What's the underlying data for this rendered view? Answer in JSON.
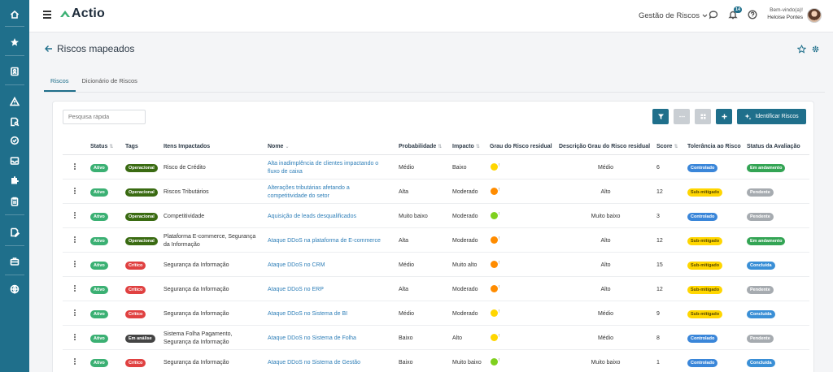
{
  "app": {
    "logo_text": "Actio",
    "module": "Gestão de Riscos",
    "notifications_count": "14"
  },
  "user": {
    "greeting": "Bem-vindo(a)!",
    "name": "Heloise Pontes"
  },
  "page": {
    "title": "Riscos mapeados"
  },
  "tabs": [
    {
      "label": "Riscos",
      "active": true
    },
    {
      "label": "Dicionário de Riscos",
      "active": false
    }
  ],
  "toolbar": {
    "search_placeholder": "Pesquisa rápida",
    "identify_label": "Identificar Riscos"
  },
  "columns": {
    "status": "Status",
    "tags": "Tags",
    "itens": "Itens Impactados",
    "nome": "Nome",
    "probabilidade": "Probabilidade",
    "impacto": "Impacto",
    "grau": "Grau do Risco residual",
    "descricao": "Descrição Grau do Risco residual",
    "score": "Score",
    "tolerancia": "Tolerância ao Risco",
    "avaliacao": "Status da Avaliação"
  },
  "colors": {
    "primary": "#1f6f8b",
    "ativo": "#3bb073",
    "operacional": "#3a6b12",
    "critico": "#e04141",
    "em_analise": "#444444",
    "controlado": "#3a86d9",
    "sub_mitigado": "#ffd600",
    "em_andamento": "#33a454",
    "pendente": "#a6abb0",
    "concluida": "#3a8fd6",
    "grau_yellow": "#ffd600",
    "grau_orange": "#ff8c00",
    "grau_green": "#7fd01f"
  },
  "rows": [
    {
      "status": "Ativo",
      "tag": "Operacional",
      "tag_type": "operacional",
      "itens": [
        "Risco de Crédito"
      ],
      "nome": [
        "Alta inadimplência de clientes impactando o",
        "fluxo de caixa"
      ],
      "probabilidade": "Médio",
      "impacto": "Baixo",
      "grau": "yellow",
      "descricao": "Médio",
      "score": "6",
      "tolerancia": "Controlado",
      "tol_type": "controlado",
      "avaliacao": "Em andamento",
      "av_type": "em_andamento"
    },
    {
      "status": "Ativo",
      "tag": "Operacional",
      "tag_type": "operacional",
      "itens": [
        "Riscos Tributários"
      ],
      "nome": [
        "Alterações tributárias afetando a",
        "competitividade do setor"
      ],
      "probabilidade": "Alta",
      "impacto": "Moderado",
      "grau": "orange",
      "descricao": "Alto",
      "score": "12",
      "tolerancia": "Sub-mitigado",
      "tol_type": "sub_mitigado",
      "avaliacao": "Pendente",
      "av_type": "pendente"
    },
    {
      "status": "Ativo",
      "tag": "Operacional",
      "tag_type": "operacional",
      "itens": [
        "Competitividade"
      ],
      "nome": [
        "Aquisição de leads desqualificados"
      ],
      "probabilidade": "Muito baixo",
      "impacto": "Moderado",
      "grau": "green",
      "descricao": "Muito baixo",
      "score": "3",
      "tolerancia": "Controlado",
      "tol_type": "controlado",
      "avaliacao": "Pendente",
      "av_type": "pendente"
    },
    {
      "status": "Ativo",
      "tag": "Operacional",
      "tag_type": "operacional",
      "itens": [
        "Plataforma E-commerce, Segurança",
        "da Informação"
      ],
      "nome": [
        "Ataque DDoS na plataforma de E-commerce"
      ],
      "probabilidade": "Alta",
      "impacto": "Moderado",
      "grau": "orange",
      "descricao": "Alto",
      "score": "12",
      "tolerancia": "Sub-mitigado",
      "tol_type": "sub_mitigado",
      "avaliacao": "Em andamento",
      "av_type": "em_andamento"
    },
    {
      "status": "Ativo",
      "tag": "Crítico",
      "tag_type": "critico",
      "itens": [
        "Segurança da Informação"
      ],
      "nome": [
        "Ataque DDoS no CRM"
      ],
      "probabilidade": "Médio",
      "impacto": "Muito alto",
      "grau": "orange",
      "descricao": "Alto",
      "score": "15",
      "tolerancia": "Sub-mitigado",
      "tol_type": "sub_mitigado",
      "avaliacao": "Concluída",
      "av_type": "concluida"
    },
    {
      "status": "Ativo",
      "tag": "Crítico",
      "tag_type": "critico",
      "itens": [
        "Segurança da Informação"
      ],
      "nome": [
        "Ataque DDoS no ERP"
      ],
      "probabilidade": "Alta",
      "impacto": "Moderado",
      "grau": "orange",
      "descricao": "Alto",
      "score": "12",
      "tolerancia": "Sub-mitigado",
      "tol_type": "sub_mitigado",
      "avaliacao": "Pendente",
      "av_type": "pendente"
    },
    {
      "status": "Ativo",
      "tag": "Crítico",
      "tag_type": "critico",
      "itens": [
        "Segurança da Informação"
      ],
      "nome": [
        "Ataque DDoS no Sistema de BI"
      ],
      "probabilidade": "Médio",
      "impacto": "Moderado",
      "grau": "yellow",
      "descricao": "Médio",
      "score": "9",
      "tolerancia": "Sub-mitigado",
      "tol_type": "sub_mitigado",
      "avaliacao": "Concluída",
      "av_type": "concluida"
    },
    {
      "status": "Ativo",
      "tag": "Em análise",
      "tag_type": "em_analise",
      "itens": [
        "Sistema Folha Pagamento,",
        "Segurança da Informação"
      ],
      "nome": [
        "Ataque DDoS no Sistema de Folha"
      ],
      "probabilidade": "Baixo",
      "impacto": "Alto",
      "grau": "yellow",
      "descricao": "Médio",
      "score": "8",
      "tolerancia": "Controlado",
      "tol_type": "controlado",
      "avaliacao": "Pendente",
      "av_type": "pendente"
    },
    {
      "status": "Ativo",
      "tag": "Crítico",
      "tag_type": "critico",
      "itens": [
        "Segurança da Informação"
      ],
      "nome": [
        "Ataque DDoS no Sistema de Gestão"
      ],
      "probabilidade": "Baixo",
      "impacto": "Muito baixo",
      "grau": "green",
      "descricao": "Muito baixo",
      "score": "1",
      "tolerancia": "Controlado",
      "tol_type": "controlado",
      "avaliacao": "Concluída",
      "av_type": "concluida"
    }
  ]
}
